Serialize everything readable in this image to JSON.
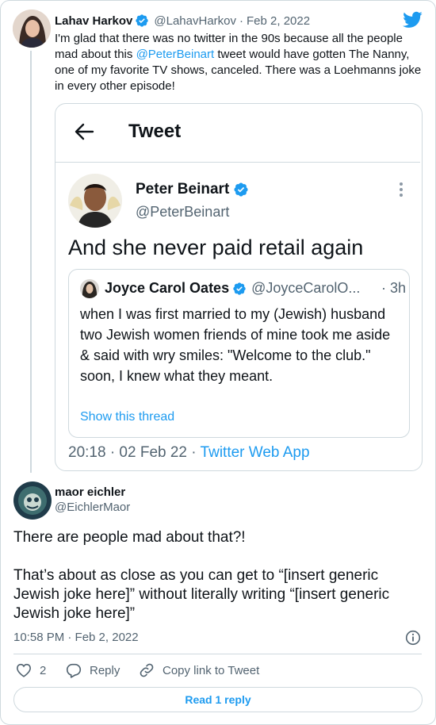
{
  "tweet": {
    "author_name": "Lahav Harkov",
    "handle": "@LahavHarkov",
    "sep": "·",
    "date": "Feb 2, 2022",
    "text_before": "I'm glad that there was no twitter in the 90s because all the people mad about this ",
    "mention": "@PeterBeinart",
    "text_after": " tweet would have gotten The Nanny, one of my favorite TV shows, canceled. There was a Loehmanns joke in every other episode!"
  },
  "embed": {
    "header_title": "Tweet",
    "author_name": "Peter Beinart",
    "handle": "@PeterBeinart",
    "text": "And she never paid retail again",
    "quote": {
      "author_name": "Joyce Carol Oates",
      "handle": "@JoyceCarolO...",
      "time": "· 3h",
      "text": "when I was first married to my (Jewish) husband two Jewish women friends of mine took me aside & said with wry smiles: \"Welcome to the club.\" soon, I knew what they meant.",
      "link": "Show this thread"
    },
    "timestamp": "20:18 · 02 Feb 22 · ",
    "source": "Twitter Web App"
  },
  "reply": {
    "author_name": "maor eichler",
    "handle": "@EichlerMaor",
    "text_line1": "There are people mad about that?!",
    "text_para2": "That’s about as close as you can get to “[insert generic Jewish joke here]” without literally writing “[insert generic Jewish joke here]”",
    "timestamp": "10:58 PM · Feb 2, 2022",
    "like_count": "2",
    "reply_label": "Reply",
    "copy_label": "Copy link to Tweet",
    "read_replies": "Read 1 reply"
  },
  "colors": {
    "accent": "#1d9bf0",
    "verified": "#1d9bf0",
    "border": "#cfd9de",
    "secondary_text": "#536471"
  },
  "icons": [
    "twitter-bird-icon",
    "verified-badge-icon",
    "back-arrow-icon",
    "more-options-icon",
    "info-icon",
    "heart-icon",
    "reply-icon",
    "link-icon"
  ]
}
